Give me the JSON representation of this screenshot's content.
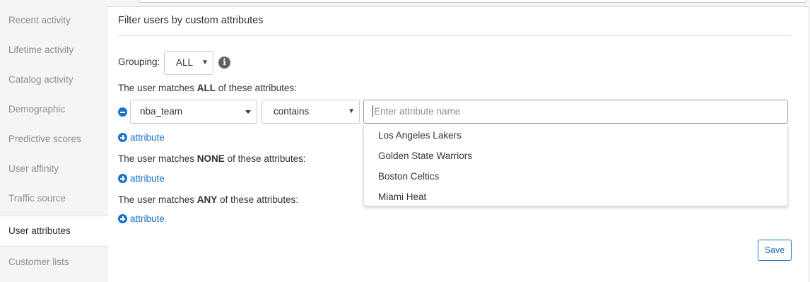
{
  "sidebar": {
    "items": [
      {
        "label": "Recent activity"
      },
      {
        "label": "Lifetime activity"
      },
      {
        "label": "Catalog activity"
      },
      {
        "label": "Demographic"
      },
      {
        "label": "Predictive scores"
      },
      {
        "label": "User affinity"
      },
      {
        "label": "Traffic source"
      },
      {
        "label": "User attributes",
        "active": true
      },
      {
        "label": "Customer lists"
      }
    ]
  },
  "panel": {
    "title": "Filter users by custom attributes",
    "grouping": {
      "label": "Grouping:",
      "value": "ALL",
      "info_icon": "info-icon"
    },
    "all_section": {
      "prefix": "The user matches ",
      "keyword": "ALL",
      "suffix": " of these attributes:"
    },
    "none_section": {
      "prefix": "The user matches ",
      "keyword": "NONE",
      "suffix": " of these attributes:"
    },
    "any_section": {
      "prefix": "The user matches ",
      "keyword": "ANY",
      "suffix": " of these attributes:"
    },
    "condition": {
      "attribute": "nba_team",
      "operator": "contains",
      "value_placeholder": "Enter attribute name"
    },
    "suggestions": [
      "Los Angeles Lakers",
      "Golden State Warriors",
      "Boston Celtics",
      "Miami Heat"
    ],
    "add_attribute_label": "attribute",
    "save_label": "Save"
  },
  "colors": {
    "accent": "#1a73c7",
    "sidebar_bg": "#f4f5f6",
    "border": "#dcdfe2"
  }
}
